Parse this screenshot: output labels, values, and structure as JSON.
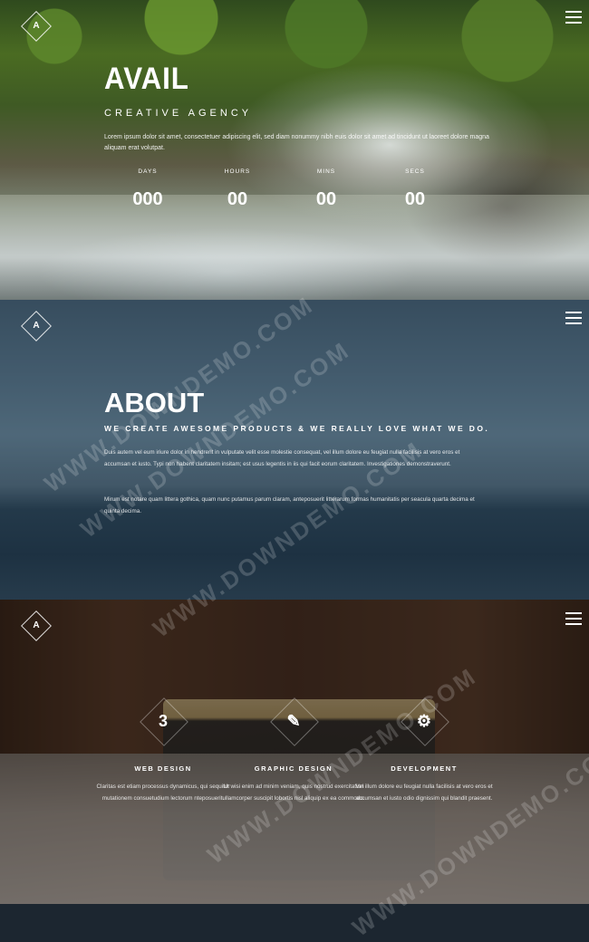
{
  "hero": {
    "logo": "A",
    "title": "AVAIL",
    "subtitle": "CREATIVE AGENCY",
    "text": "Lorem ipsum dolor sit amet, consectetuer adipiscing elit, sed diam nonummy nibh euis dolor sit amet ad tincidunt ut laoreet dolore magna aliquam erat volutpat.",
    "countdown": [
      {
        "label": "DAYS",
        "value": "000"
      },
      {
        "label": "HOURS",
        "value": "00"
      },
      {
        "label": "MINS",
        "value": "00"
      },
      {
        "label": "SECS",
        "value": "00"
      }
    ]
  },
  "about": {
    "logo": "A",
    "title": "ABOUT",
    "subtitle": "WE CREATE AWESOME PRODUCTS & WE REALLY LOVE WHAT WE DO.",
    "paragraph1": "Duis autem vel eum iriure dolor in hendrerit in vulputate velit esse molestie consequat, vel illum dolore eu feugiat nulla facilisis at vero eros et accumsan et iusto. Typi non habent claritatem insitam; est usus legentis in iis qui facit eorum claritatem. Investigationes demonstraverunt.",
    "paragraph2": "Mirum est notare quam littera gothica, quam nunc putamus parum claram, anteposuerit litterarum formas humanitatis per seacula quarta decima et quinta decima."
  },
  "services": {
    "logo": "A",
    "items": [
      {
        "icon": "css3-icon",
        "glyph": "3",
        "title": "WEB DESIGN",
        "text": "Claritas est etiam processus dynamicus, qui sequitur mutationem consuetudium lectorum nteposuerit."
      },
      {
        "icon": "pencil-icon",
        "glyph": "✎",
        "title": "GRAPHIC DESIGN",
        "text": "Ut wisi enim ad minim veniam, quis nostrud exercitation ullamcorper suscipit lobortis nisl aliquip ex ea commodo."
      },
      {
        "icon": "gear-icon",
        "glyph": "⚙",
        "title": "DEVELOPMENT",
        "text": "Vel illum dolore eu feugiat nulla facilisis at vero eros et accumsan et iusto odio dignissim qui blandit praesent."
      }
    ]
  },
  "watermarks": [
    "WWW.DOWNDEMO.COM",
    "WWW.DOWNDEMO.COM",
    "WWW.DOWNDEMO.COM",
    "WWW.DOWNDEMO.COM",
    "WWW.DOWNDEMO.COM"
  ]
}
